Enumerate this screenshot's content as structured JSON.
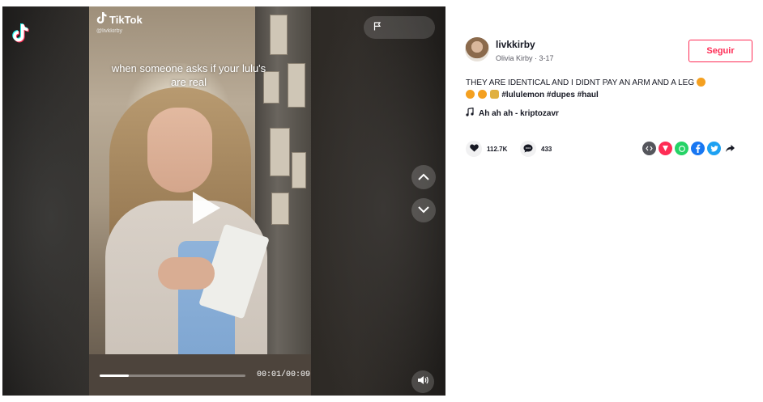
{
  "video": {
    "watermark_brand": "TikTok",
    "watermark_handle": "@livkkirby",
    "caption_overlay": "when someone asks if your lulu's are real",
    "time": "00:01/00:09",
    "progress": 0.2
  },
  "author": {
    "username": "livkkirby",
    "subline": "Olivia Kirby · 3-17",
    "follow_label": "Seguir"
  },
  "description": {
    "text": "THEY ARE IDENTICAL AND I DIDNT PAY AN ARM AND A LEG",
    "hashtags": "#lululemon #dupes #haul"
  },
  "music": {
    "title": "Ah ah ah - kriptozavr"
  },
  "stats": {
    "likes": "112.7K",
    "comments": "433"
  },
  "share": {
    "icons": [
      "embed-icon",
      "send-icon",
      "whatsapp-icon",
      "facebook-icon",
      "twitter-icon",
      "share-arrow-icon"
    ]
  },
  "colors": {
    "accent": "#fe2c55",
    "text": "#161823",
    "whatsapp": "#25d366",
    "facebook": "#1877f2",
    "twitter": "#1da1f2"
  }
}
